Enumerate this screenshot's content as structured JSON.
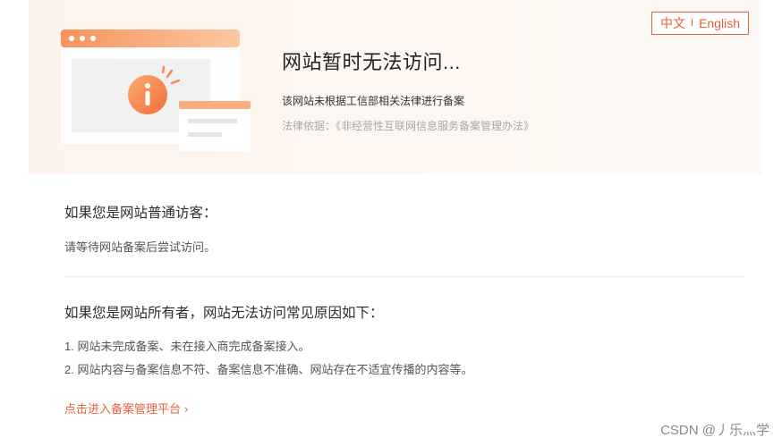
{
  "lang_switch": {
    "cn": "中文",
    "sep": "I",
    "en": "English"
  },
  "hero": {
    "title": "网站暂时无法访问...",
    "subtitle": "该网站未根据工信部相关法律进行备案",
    "law": "法律依据：《非经营性互联网信息服务备案管理办法》"
  },
  "visitor": {
    "title": "如果您是网站普通访客：",
    "text": "请等待网站备案后尝试访问。"
  },
  "owner": {
    "title": "如果您是网站所有者，网站无法访问常见原因如下：",
    "reasons": [
      "1. 网站未完成备案、未在接入商完成备案接入。",
      "2. 网站内容与备案信息不符、备案信息不准确、网站存在不适宜传播的内容等。"
    ]
  },
  "link": {
    "label": "点击进入备案管理平台",
    "arrow": "›"
  },
  "watermark": "CSDN @丿乐灬学",
  "colors": {
    "accent": "#e8613a",
    "hero_bg": "#fdf3ec",
    "icon_orange": "#f79a5c"
  }
}
